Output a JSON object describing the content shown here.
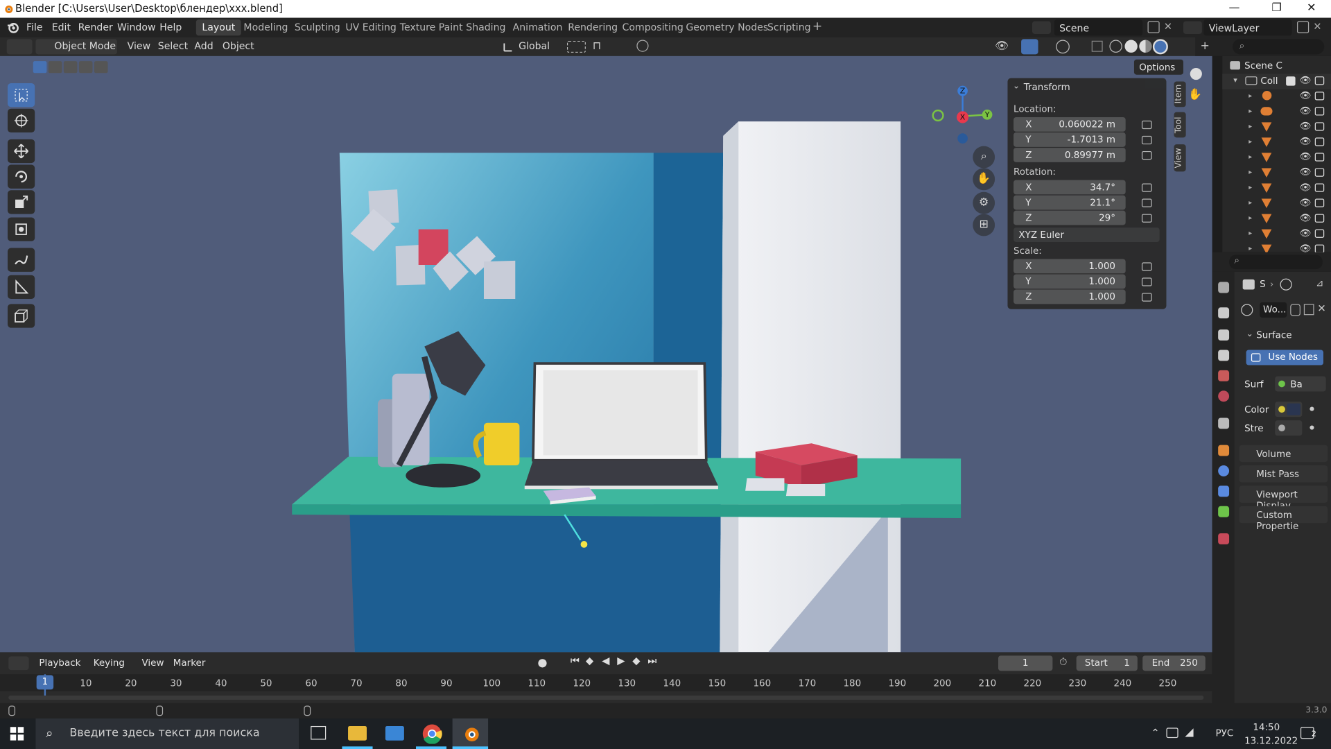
{
  "window": {
    "title": "Blender [C:\\Users\\User\\Desktop\\блендер\\xxx.blend]",
    "minimize": "—",
    "restore": "❐",
    "close": "✕"
  },
  "menu": [
    "File",
    "Edit",
    "Render",
    "Window",
    "Help"
  ],
  "workspaces": [
    "Layout",
    "Modeling",
    "Sculpting",
    "UV Editing",
    "Texture Paint",
    "Shading",
    "Animation",
    "Rendering",
    "Compositing",
    "Geometry Nodes",
    "Scripting",
    "+"
  ],
  "scene": "Scene",
  "view_layer": "ViewLayer",
  "header": {
    "mode": "Object Mode",
    "view": "View",
    "select": "Select",
    "add": "Add",
    "object": "Object",
    "orientation": "Global",
    "options": "Options"
  },
  "gizmo": {
    "z": "Z",
    "y": "Y",
    "x": "X"
  },
  "transform": {
    "title": "Transform",
    "location_label": "Location:",
    "location": [
      {
        "axis": "X",
        "value": "0.060022 m"
      },
      {
        "axis": "Y",
        "value": "-1.7013 m"
      },
      {
        "axis": "Z",
        "value": "0.89977 m"
      }
    ],
    "rotation_label": "Rotation:",
    "rotation": [
      {
        "axis": "X",
        "value": "34.7°"
      },
      {
        "axis": "Y",
        "value": "21.1°"
      },
      {
        "axis": "Z",
        "value": "29°"
      }
    ],
    "rotation_mode": "XYZ Euler",
    "scale_label": "Scale:",
    "scale": [
      {
        "axis": "X",
        "value": "1.000"
      },
      {
        "axis": "Y",
        "value": "1.000"
      },
      {
        "axis": "Z",
        "value": "1.000"
      }
    ]
  },
  "side_tabs": [
    "Item",
    "Tool",
    "View"
  ],
  "outliner": {
    "scene": "Scene C",
    "collection": "Coll"
  },
  "properties": {
    "breadcrumb": "S",
    "world_name": "Wo...",
    "surface": "Surface",
    "use_nodes": "Use Nodes",
    "surf_label": "Surf",
    "surf_value": "Ba",
    "color_label": "Color",
    "strength_label": "Stre",
    "sections": [
      "Volume",
      "Mist Pass",
      "Viewport Display",
      "Custom Propertie"
    ]
  },
  "timeline": {
    "playback": "Playback",
    "keying": "Keying",
    "view": "View",
    "marker": "Marker",
    "current": "1",
    "start_label": "Start",
    "start": "1",
    "end_label": "End",
    "end": "250",
    "ticks": [
      "1",
      "10",
      "20",
      "30",
      "40",
      "50",
      "60",
      "70",
      "80",
      "90",
      "100",
      "110",
      "120",
      "130",
      "140",
      "150",
      "160",
      "170",
      "180",
      "190",
      "200",
      "210",
      "220",
      "230",
      "240",
      "250"
    ]
  },
  "version": "3.3.0",
  "taskbar": {
    "search": "Введите здесь текст для поиска",
    "lang": "РУС",
    "time": "14:50",
    "date": "13.12.2022",
    "notif": "2"
  }
}
